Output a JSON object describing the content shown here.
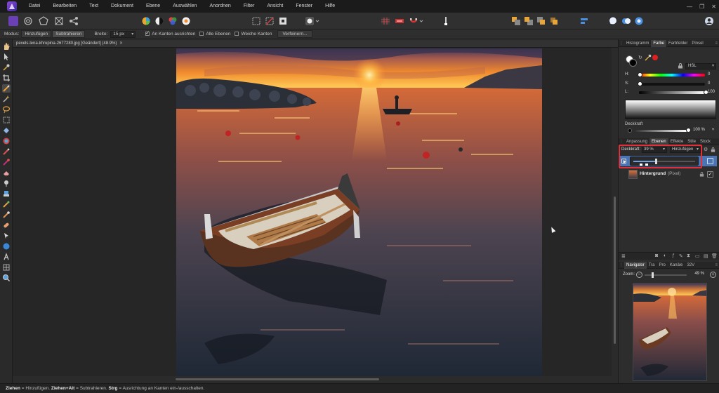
{
  "menu": {
    "items": [
      "Datei",
      "Bearbeiten",
      "Text",
      "Dokument",
      "Ebene",
      "Auswählen",
      "Anordnen",
      "Filter",
      "Ansicht",
      "Fenster",
      "Hilfe"
    ]
  },
  "context_bar": {
    "mode_label": "Modus:",
    "mode_add": "Hinzufügen",
    "mode_subtract": "Subtrahieren",
    "width_label": "Breite:",
    "width_value": "15 px",
    "snap_edges": "An Kanten ausrichten",
    "all_layers": "Alle Ebenen",
    "soft_edges": "Weiche Kanten",
    "refine_button": "Verfeinern..."
  },
  "document": {
    "tab_title": "pexels-lena-khrupina-2677280.jpg [Geändert] (48.9%)"
  },
  "status_bar": {
    "drag": "Ziehen",
    "drag_text": " = Hinzufügen. ",
    "drag_alt": "Ziehen+Alt",
    "drag_alt_text": " = Subtrahieren. ",
    "ctrl": "Strg",
    "ctrl_text": " = Ausrichtung an Kanten ein-/ausschalten."
  },
  "panels": {
    "top_tabs": [
      "Histogramm",
      "Farbe",
      "Farbfelder",
      "Pinsel"
    ],
    "top_active": "Farbe",
    "color_model": "HSL",
    "color_sliders": [
      {
        "label": "H:",
        "value": "0"
      },
      {
        "label": "S:",
        "value": "0"
      },
      {
        "label": "L:",
        "value": "100"
      }
    ],
    "opacity_label": "Deckkraft",
    "opacity_value": "100 %",
    "mid_tabs": [
      "Anpassung",
      "Ebenen",
      "Effekte",
      "Stile",
      "Stock"
    ],
    "mid_active": "Ebenen",
    "layer_opacity_label": "Deckkraft:",
    "layer_opacity_value": "39 %",
    "layer_blend_mode": "Hinzufügen",
    "layers": [
      {
        "name": "Hintergrund",
        "type": "(Pixel)"
      }
    ],
    "bottom_tabs": [
      "Navigator",
      "Tra",
      "Pro",
      "Kanäle",
      "32V"
    ],
    "bottom_active": "Navigator",
    "zoom_label": "Zoom:",
    "zoom_value": "49 %"
  },
  "colors": {
    "accent_highlight": "#e0303a",
    "selected_layer": "#4a74b4",
    "app_brand": "#7a45c8"
  }
}
